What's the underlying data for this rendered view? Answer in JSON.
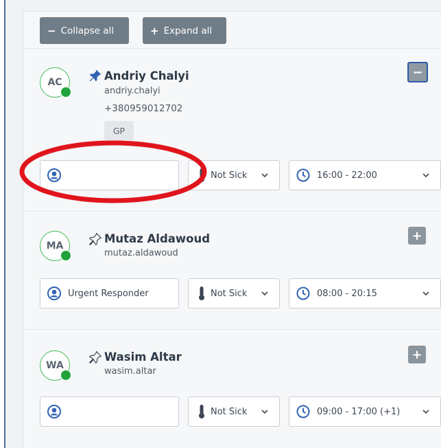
{
  "toolbar": {
    "collapse_label": "Collapse all",
    "expand_label": "Expand all",
    "collapse_glyph": "−",
    "expand_glyph": "+"
  },
  "staff": [
    {
      "initials": "AC",
      "name": "Andriy Chalyi",
      "login": "andriy.chalyi",
      "phone": "+380959012702",
      "tag": "GP",
      "pinned": true,
      "expanded": true,
      "role": "",
      "sick_status": "Not Sick",
      "shift": "16:00 - 22:00",
      "toggle_glyph": "−"
    },
    {
      "initials": "MA",
      "name": "Mutaz Aldawoud",
      "login": "mutaz.aldawoud",
      "pinned": false,
      "expanded": false,
      "role": "Urgent Responder",
      "sick_status": "Not Sick",
      "shift": "08:00 - 20:15",
      "toggle_glyph": "+"
    },
    {
      "initials": "WA",
      "name": "Wasim Altar",
      "login": "wasim.altar",
      "pinned": false,
      "expanded": false,
      "role": "",
      "sick_status": "Not Sick",
      "shift": "09:00 - 17:00 (+1)",
      "toggle_glyph": "+"
    }
  ],
  "colors": {
    "online": "#1fa33a",
    "avatar_ring": "#3dba55",
    "button": "#6f7d88",
    "icon_blue": "#2f63b5",
    "annotation": "#e0141c"
  },
  "icons": {
    "role": "person-circle-icon",
    "sick": "thermometer-icon",
    "shift": "clock-icon",
    "pin_filled": "pin-filled-icon",
    "pin_outline": "pin-outline-icon",
    "dropdown": "chevron-down-icon"
  }
}
